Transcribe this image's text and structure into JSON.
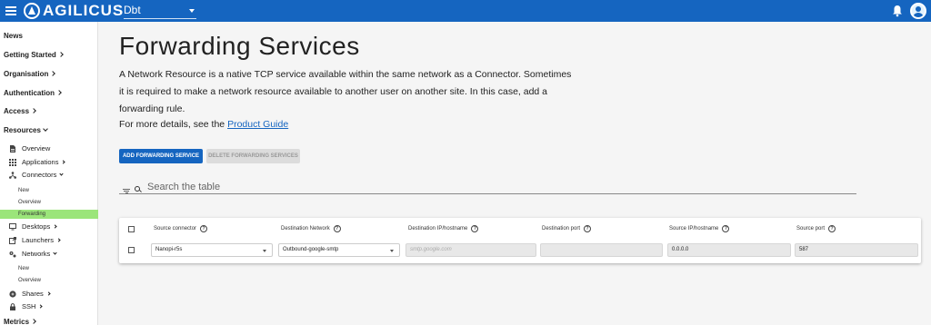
{
  "header": {
    "logo_text": "AGILICUS",
    "org_selector": "Dbt"
  },
  "sidebar": {
    "top_items": [
      {
        "label": "News"
      },
      {
        "label": "Getting Started"
      },
      {
        "label": "Organisation"
      },
      {
        "label": "Authentication"
      },
      {
        "label": "Access"
      },
      {
        "label": "Resources"
      },
      {
        "label": "Metrics"
      }
    ],
    "resource_items": [
      {
        "label": "Overview"
      },
      {
        "label": "Applications"
      },
      {
        "label": "Connectors"
      },
      {
        "label": "Desktops"
      },
      {
        "label": "Launchers"
      },
      {
        "label": "Networks"
      },
      {
        "label": "Shares"
      },
      {
        "label": "SSH"
      }
    ],
    "connector_subitems": [
      {
        "label": "New"
      },
      {
        "label": "Overview"
      },
      {
        "label": "Forwarding"
      }
    ],
    "network_subitems": [
      {
        "label": "New"
      },
      {
        "label": "Overview"
      }
    ]
  },
  "main": {
    "title": "Forwarding Services",
    "description": "A Network Resource is a native TCP service available within the same network as a Connector. Sometimes it is required to make a network resource available to another user on another site. In this case, add a forwarding rule.",
    "details_prefix": "For more details, see the ",
    "details_link": "Product Guide",
    "add_button": "ADD FORWARDING SERVICE",
    "delete_button": "DELETE FORWARDING SERVICES",
    "search_placeholder": "Search the table"
  },
  "table": {
    "columns": [
      "Source connector",
      "Destination Network",
      "Destination IP/hostname",
      "Destination port",
      "Source IP/hostname",
      "Source port"
    ],
    "rows": [
      {
        "source_connector": "Nanopi-r5s",
        "destination_network": "Outbound-google-smtp",
        "destination_host_placeholder": "smtp.google.com",
        "destination_port": "",
        "source_ip": "0.0.0.0",
        "source_port": "587"
      }
    ]
  },
  "colors": {
    "primary": "#1565c0",
    "active_nav": "#9be57a"
  }
}
